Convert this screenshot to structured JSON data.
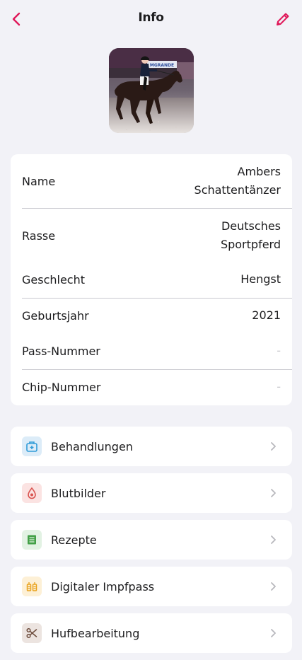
{
  "nav": {
    "title": "Info"
  },
  "details": [
    {
      "label": "Name",
      "value": "Ambers\nSchattentänzer"
    },
    {
      "label": "Rasse",
      "value": "Deutsches\nSportpferd"
    },
    {
      "label": "Geschlecht",
      "value": "Hengst"
    },
    {
      "label": "Geburtsjahr",
      "value": "2021"
    },
    {
      "label": "Pass-Nummer",
      "value": "-"
    },
    {
      "label": "Chip-Nummer",
      "value": "-"
    }
  ],
  "menu": [
    {
      "label": "Behandlungen",
      "icon": "medical-kit-icon",
      "color": "#2f9bd8"
    },
    {
      "label": "Blutbilder",
      "icon": "blood-drop-icon",
      "color": "#d9534f"
    },
    {
      "label": "Rezepte",
      "icon": "prescription-list-icon",
      "color": "#43a047"
    },
    {
      "label": "Digitaler Impfpass",
      "icon": "vaccine-icon",
      "color": "#e9a21c"
    },
    {
      "label": "Hufbearbeitung",
      "icon": "hoof-tools-icon",
      "color": "#6b4a3a"
    }
  ],
  "colors": {
    "accent": "#e0195a",
    "background": "#f2f2f7"
  },
  "banner": {
    "text": "MGRANDE"
  }
}
